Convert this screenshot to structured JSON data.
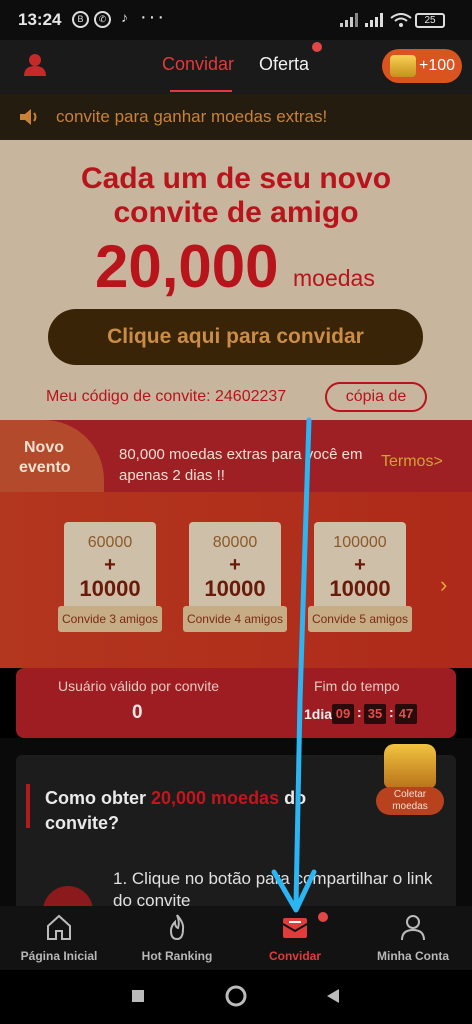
{
  "status_bar": {
    "time": "13:24",
    "icons": [
      "b-icon",
      "whatsapp-icon",
      "tiktok-icon",
      "more-icon",
      "signal-icon",
      "signal-icon",
      "wifi-icon"
    ],
    "battery": "25"
  },
  "header": {
    "tab_invite": "Convidar",
    "tab_offer": "Oferta",
    "coins": "+100"
  },
  "marquee": {
    "text": "convite para ganhar moedas extras!"
  },
  "hero": {
    "title_line1": "Cada um de seu novo",
    "title_line2": "convite de amigo",
    "amount": "20,000",
    "unit": "moedas",
    "invite_button": "Clique aqui para convidar",
    "code_label": "Meu código de convite: 24602237",
    "copy_button": "cópia de"
  },
  "event": {
    "badge_line1": "Novo",
    "badge_line2": "evento",
    "text": "80,000 moedas extras para você em apenas 2 dias !!",
    "terms": "Termos>"
  },
  "cards": [
    {
      "top": "60000",
      "plus": "+",
      "bottom": "10000",
      "label": "Convide 3 amigos"
    },
    {
      "top": "80000",
      "plus": "+",
      "bottom": "10000",
      "label": "Convide 4 amigos"
    },
    {
      "top": "100000",
      "plus": "+",
      "bottom": "10000",
      "label": "Convide 5 amigos"
    }
  ],
  "stats": {
    "valid_label": "Usuário válido por convite",
    "valid_value": "0",
    "end_label": "Fim do tempo",
    "day": "1dia",
    "hours": "09",
    "minutes": "35",
    "seconds": "47"
  },
  "how": {
    "title_prefix": "Como obter ",
    "title_highlight": "20,000 moedas",
    "title_suffix": " do convite?",
    "step1": "1. Clique no botão para compartilhar o link do convite"
  },
  "chest": {
    "label": "Coletar moedas"
  },
  "nav": {
    "home": "Página Inicial",
    "ranking": "Hot Ranking",
    "invite": "Convidar",
    "account": "Minha Conta"
  },
  "colors": {
    "accent_red": "#e03a3a",
    "arrow": "#2bb5f2"
  }
}
